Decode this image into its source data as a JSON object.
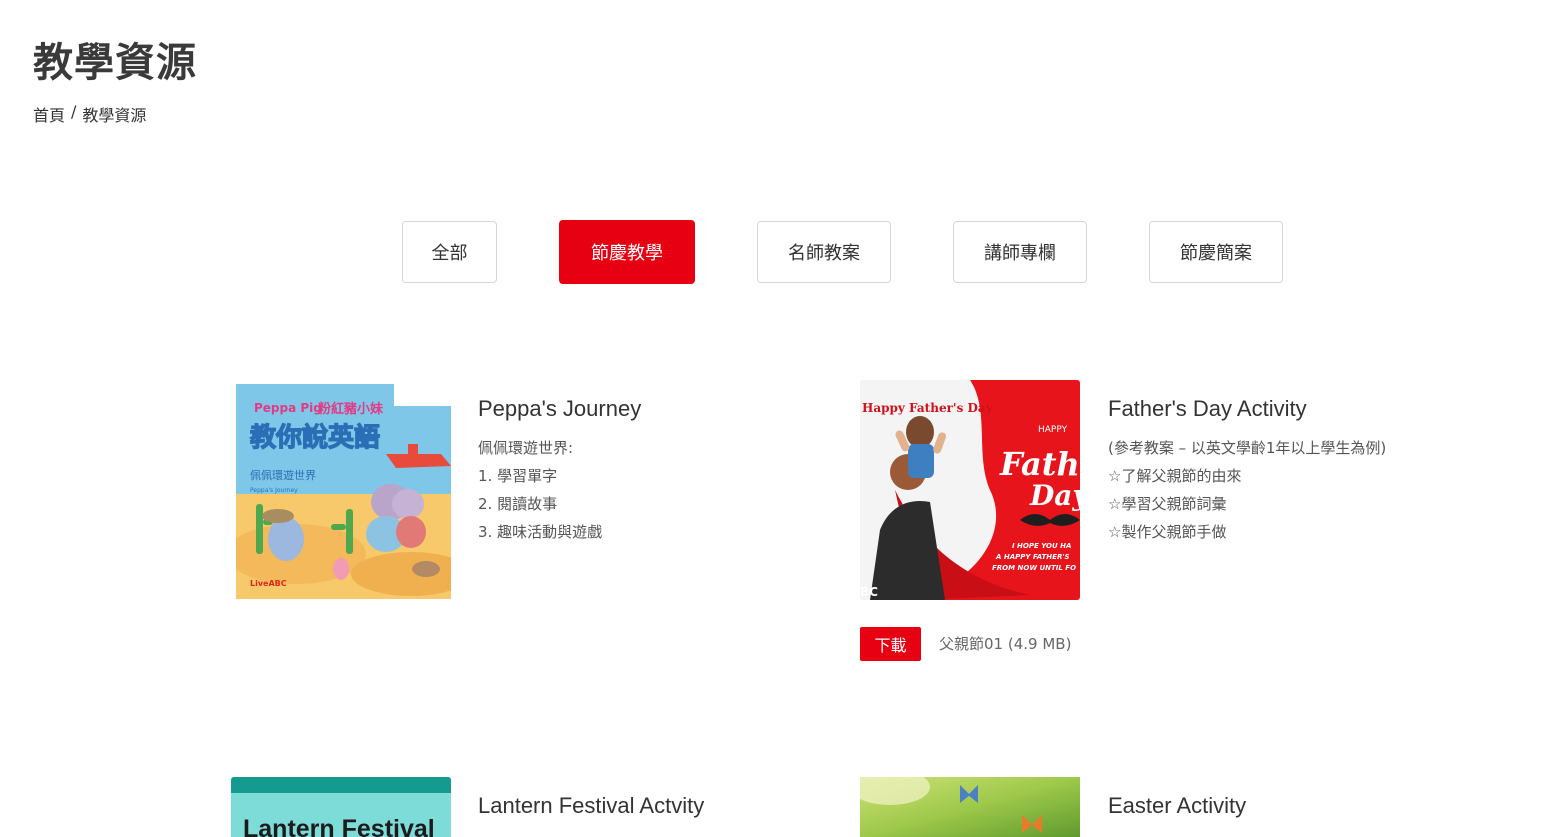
{
  "header": {
    "title": "教學資源"
  },
  "breadcrumb": {
    "home": "首頁",
    "separator": "/",
    "current": "教學資源"
  },
  "filters": [
    {
      "label": "全部",
      "active": false
    },
    {
      "label": "節慶教學",
      "active": true
    },
    {
      "label": "名師教案",
      "active": false
    },
    {
      "label": "講師專欄",
      "active": false
    },
    {
      "label": "節慶簡案",
      "active": false
    }
  ],
  "colors": {
    "accent": "#e60012",
    "text": "#333333"
  },
  "cards": [
    {
      "title": "Peppa's Journey",
      "desc": [
        "佩佩環遊世界:",
        "1. 學習單字",
        "2. 閱讀故事",
        "3. 趣味活動與遊戲"
      ],
      "thumb": {
        "brand": "Peppa Pig",
        "cn_title": "粉紅豬小妹",
        "cn_subtitle": "教你說英語",
        "sub": "佩佩環遊世界",
        "sub_en": "Peppa's Journey",
        "publisher": "LiveABC"
      }
    },
    {
      "title": "Father's Day Activity",
      "desc": [
        "(參考教案 – 以英文學齡1年以上學生為例)",
        "☆了解父親節的由來",
        "☆學習父親節詞彙",
        "☆製作父親節手做"
      ],
      "thumb": {
        "banner": "Happy Father's Day",
        "happy": "HAPPY",
        "big1": "Father",
        "big2": "Day",
        "small1": "I HOPE YOU HA",
        "small2": "A HAPPY FATHER'S",
        "small3": "FROM NOW UNTIL FO",
        "corner": "BC"
      },
      "download": {
        "button": "下載",
        "file": "父親節01 (4.9 MB)"
      }
    },
    {
      "title": "Lantern Festival Actvity",
      "thumb": {
        "text": "Lantern Festival"
      }
    },
    {
      "title": "Easter Activity",
      "thumb": {}
    }
  ]
}
